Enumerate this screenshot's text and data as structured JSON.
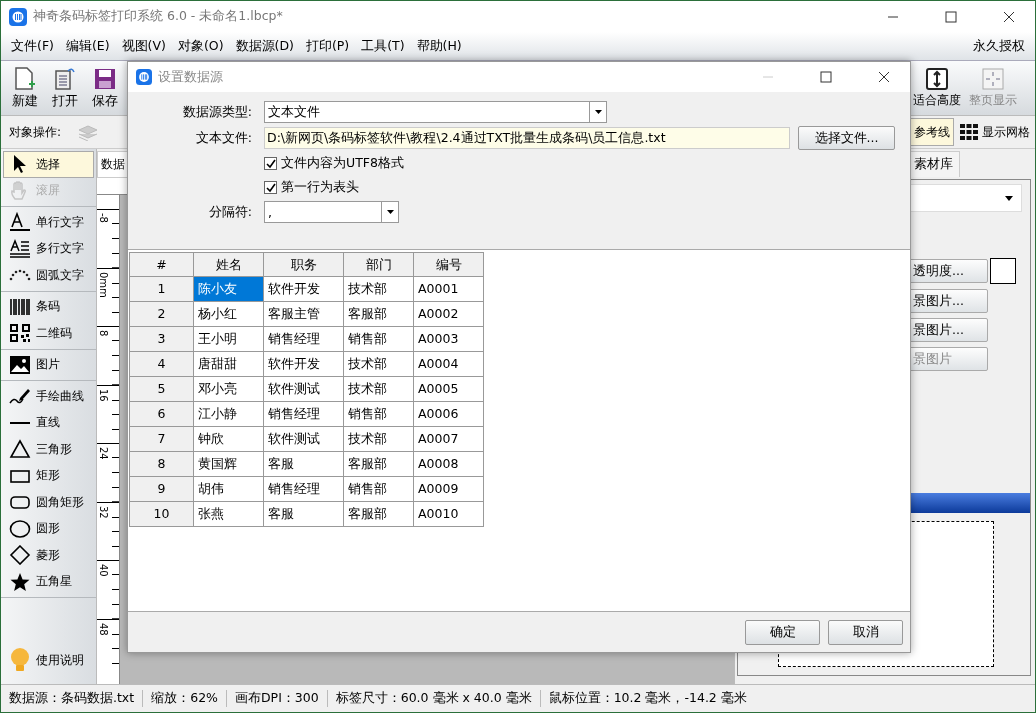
{
  "window": {
    "title": "神奇条码标签打印系统 6.0 - 未命名1.lbcp*"
  },
  "menu": [
    {
      "label": "文件(F)"
    },
    {
      "label": "编辑(E)"
    },
    {
      "label": "视图(V)"
    },
    {
      "label": "对象(O)"
    },
    {
      "label": "数据源(D)"
    },
    {
      "label": "打印(P)"
    },
    {
      "label": "工具(T)"
    },
    {
      "label": "帮助(H)"
    }
  ],
  "license": "永久授权",
  "toolbar_left": [
    {
      "label": "新建",
      "kind": "new"
    },
    {
      "label": "打开",
      "kind": "open"
    },
    {
      "label": "保存",
      "kind": "save"
    }
  ],
  "toolbar_right": [
    {
      "label": "适合高度",
      "kind": "fit",
      "disabled": false
    },
    {
      "label": "整页显示",
      "kind": "page",
      "disabled": true
    }
  ],
  "object_ops": {
    "label": "对象操作:"
  },
  "view_toggles": [
    {
      "label": "参考线",
      "kind": "guide",
      "selected": true
    },
    {
      "label": "显示网格",
      "kind": "grid",
      "selected": false
    }
  ],
  "tool_groups": [
    [
      {
        "label": "选择",
        "kind": "select",
        "selected": true,
        "disabled": false
      },
      {
        "label": "滚屏",
        "kind": "hand",
        "selected": false,
        "disabled": true
      }
    ],
    [
      {
        "label": "单行文字",
        "kind": "text",
        "selected": false,
        "disabled": false
      },
      {
        "label": "多行文字",
        "kind": "multitext",
        "selected": false,
        "disabled": false
      },
      {
        "label": "圆弧文字",
        "kind": "arctext",
        "selected": false,
        "disabled": false
      }
    ],
    [
      {
        "label": "条码",
        "kind": "barcode",
        "selected": false,
        "disabled": false
      },
      {
        "label": "二维码",
        "kind": "qrcode",
        "selected": false,
        "disabled": false
      }
    ],
    [
      {
        "label": "图片",
        "kind": "image",
        "selected": false,
        "disabled": false
      }
    ],
    [
      {
        "label": "手绘曲线",
        "kind": "pen",
        "selected": false,
        "disabled": false
      },
      {
        "label": "直线",
        "kind": "line",
        "selected": false,
        "disabled": false
      },
      {
        "label": "三角形",
        "kind": "triangle",
        "selected": false,
        "disabled": false
      },
      {
        "label": "矩形",
        "kind": "rect",
        "selected": false,
        "disabled": false
      },
      {
        "label": "圆角矩形",
        "kind": "roundrect",
        "selected": false,
        "disabled": false
      },
      {
        "label": "圆形",
        "kind": "ellipse",
        "selected": false,
        "disabled": false
      },
      {
        "label": "菱形",
        "kind": "diamond",
        "selected": false,
        "disabled": false
      },
      {
        "label": "五角星",
        "kind": "star",
        "selected": false,
        "disabled": false
      }
    ]
  ],
  "help": {
    "label": "使用说明"
  },
  "canvas": {
    "tab": "数据",
    "ruler_labels": [
      "-8",
      "0mm",
      "8",
      "16",
      "24",
      "32",
      "40",
      "48"
    ]
  },
  "right_panel": {
    "tab": "素材库",
    "buttons": [
      {
        "label": "透明度...",
        "disabled": false
      },
      {
        "label": "景图片...",
        "disabled": false
      },
      {
        "label": "景图片...",
        "disabled": false
      },
      {
        "label": "景图片",
        "disabled": true
      }
    ]
  },
  "dialog": {
    "title": "设置数据源",
    "type_label": "数据源类型:",
    "type_value": "文本文件",
    "file_label": "文本文件:",
    "file_value": "D:\\新网页\\条码标签软件\\教程\\2.4通过TXT批量生成条码\\员工信息.txt",
    "file_button": "选择文件...",
    "options": [
      {
        "label": "文件内容为UTF8格式",
        "checked": true
      },
      {
        "label": "第一行为表头",
        "checked": true
      }
    ],
    "separator_label": "分隔符:",
    "separator_value": ",",
    "table": {
      "corner": "#",
      "columns": [
        "姓名",
        "职务",
        "部门",
        "编号"
      ],
      "rows": [
        {
          "num": "1",
          "cells": [
            {
              "text": "陈小友",
              "selected": true
            },
            {
              "text": "软件开发",
              "selected": false
            },
            {
              "text": "技术部",
              "selected": false
            },
            {
              "text": "A0001",
              "selected": false
            }
          ]
        },
        {
          "num": "2",
          "cells": [
            {
              "text": "杨小红",
              "selected": false
            },
            {
              "text": "客服主管",
              "selected": false
            },
            {
              "text": "客服部",
              "selected": false
            },
            {
              "text": "A0002",
              "selected": false
            }
          ]
        },
        {
          "num": "3",
          "cells": [
            {
              "text": "王小明",
              "selected": false
            },
            {
              "text": "销售经理",
              "selected": false
            },
            {
              "text": "销售部",
              "selected": false
            },
            {
              "text": "A0003",
              "selected": false
            }
          ]
        },
        {
          "num": "4",
          "cells": [
            {
              "text": "唐甜甜",
              "selected": false
            },
            {
              "text": "软件开发",
              "selected": false
            },
            {
              "text": "技术部",
              "selected": false
            },
            {
              "text": "A0004",
              "selected": false
            }
          ]
        },
        {
          "num": "5",
          "cells": [
            {
              "text": "邓小亮",
              "selected": false
            },
            {
              "text": "软件测试",
              "selected": false
            },
            {
              "text": "技术部",
              "selected": false
            },
            {
              "text": "A0005",
              "selected": false
            }
          ]
        },
        {
          "num": "6",
          "cells": [
            {
              "text": "江小静",
              "selected": false
            },
            {
              "text": "销售经理",
              "selected": false
            },
            {
              "text": "销售部",
              "selected": false
            },
            {
              "text": "A0006",
              "selected": false
            }
          ]
        },
        {
          "num": "7",
          "cells": [
            {
              "text": "钟欣",
              "selected": false
            },
            {
              "text": "软件测试",
              "selected": false
            },
            {
              "text": "技术部",
              "selected": false
            },
            {
              "text": "A0007",
              "selected": false
            }
          ]
        },
        {
          "num": "8",
          "cells": [
            {
              "text": "黄国辉",
              "selected": false
            },
            {
              "text": "客服",
              "selected": false
            },
            {
              "text": "客服部",
              "selected": false
            },
            {
              "text": "A0008",
              "selected": false
            }
          ]
        },
        {
          "num": "9",
          "cells": [
            {
              "text": "胡伟",
              "selected": false
            },
            {
              "text": "销售经理",
              "selected": false
            },
            {
              "text": "销售部",
              "selected": false
            },
            {
              "text": "A0009",
              "selected": false
            }
          ]
        },
        {
          "num": "10",
          "cells": [
            {
              "text": "张燕",
              "selected": false
            },
            {
              "text": "客服",
              "selected": false
            },
            {
              "text": "客服部",
              "selected": false
            },
            {
              "text": "A0010",
              "selected": false
            }
          ]
        }
      ]
    },
    "buttons": [
      "确定",
      "取消"
    ]
  },
  "status_bar": [
    "数据源：条码数据.txt",
    "缩放：62%",
    "画布DPI：300",
    "标签尺寸：60.0 毫米 x 40.0 毫米",
    "鼠标位置：10.2 毫米，-14.2 毫米"
  ]
}
